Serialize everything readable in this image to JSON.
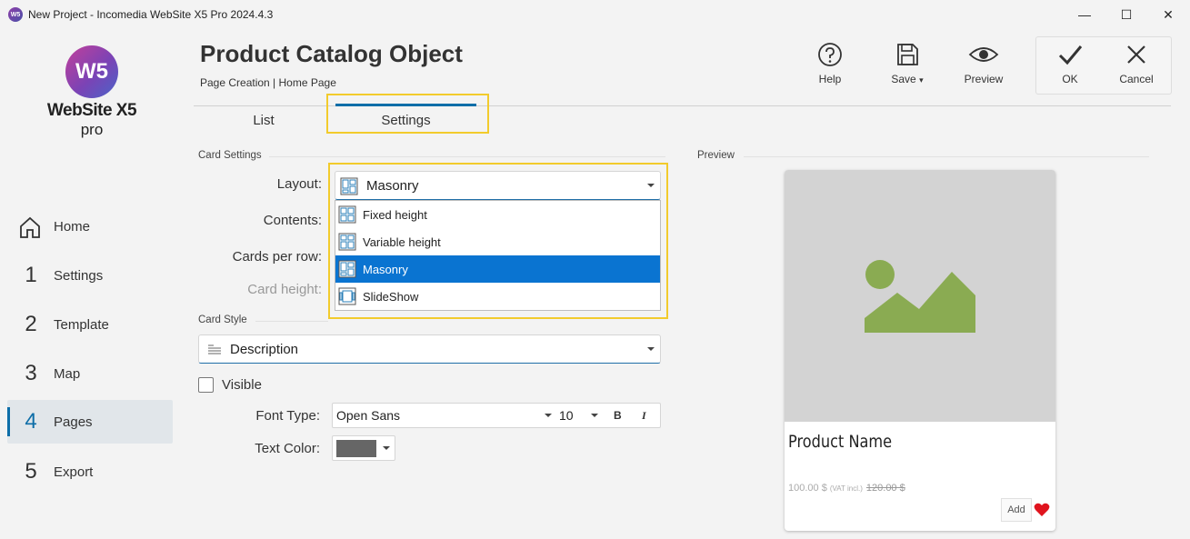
{
  "window": {
    "title": "New Project - Incomedia WebSite X5 Pro 2024.4.3",
    "app_icon_text": "W5",
    "minimize": "—",
    "maximize": "☐",
    "close": "✕"
  },
  "logo": {
    "mark": "W5",
    "line1": "WebSite X5",
    "line2": "pro"
  },
  "sidebar": {
    "items": [
      {
        "num": "",
        "label": "Home"
      },
      {
        "num": "1",
        "label": "Settings"
      },
      {
        "num": "2",
        "label": "Template"
      },
      {
        "num": "3",
        "label": "Map"
      },
      {
        "num": "4",
        "label": "Pages"
      },
      {
        "num": "5",
        "label": "Export"
      }
    ],
    "active_index": 4
  },
  "header": {
    "title": "Product Catalog Object",
    "breadcrumb": "Page Creation | Home Page"
  },
  "toolbar": {
    "help": "Help",
    "save": "Save",
    "save_caret": "▾",
    "preview": "Preview",
    "ok": "OK",
    "cancel": "Cancel"
  },
  "tabs": [
    {
      "label": "List"
    },
    {
      "label": "Settings"
    }
  ],
  "active_tab": "Settings",
  "card_settings": {
    "section": "Card Settings",
    "layout_label": "Layout:",
    "layout_value": "Masonry",
    "contents_label": "Contents:",
    "cards_per_row_label": "Cards per row:",
    "card_height_label": "Card height:",
    "layout_options": [
      {
        "label": "Fixed height",
        "icon": "fixed-height-layout-icon"
      },
      {
        "label": "Variable height",
        "icon": "variable-height-layout-icon"
      },
      {
        "label": "Masonry",
        "icon": "masonry-layout-icon"
      },
      {
        "label": "SlideShow",
        "icon": "slideshow-layout-icon"
      }
    ],
    "selected_option": "Masonry"
  },
  "card_style": {
    "section": "Card Style",
    "value": "Description",
    "visible_label": "Visible",
    "visible_checked": false,
    "font_type_label": "Font Type:",
    "font_value": "Open Sans",
    "font_size": "10",
    "bold": "B",
    "italic": "I",
    "text_color_label": "Text Color:",
    "text_color": "#666666"
  },
  "preview": {
    "section": "Preview",
    "product_name": "Product Name",
    "price": "100.00 $",
    "vat": "(VAT incl.)",
    "old_price": "120.00 $",
    "add_label": "Add"
  },
  "colors": {
    "accent": "#0d6ea8",
    "highlight": "#f2cb2c",
    "selection": "#0a74d1",
    "image_placeholder": "#d3d3d3",
    "image_icon": "#8aab52",
    "heart": "#e0141e"
  }
}
